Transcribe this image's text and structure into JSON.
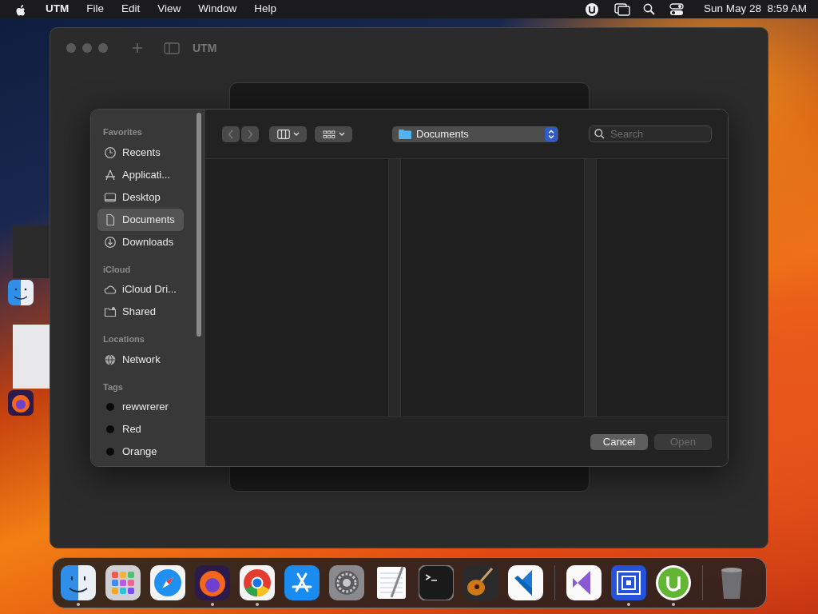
{
  "menu_bar": {
    "app": "UTM",
    "menus": [
      "File",
      "Edit",
      "View",
      "Window",
      "Help"
    ],
    "clock": "Sun May 28  8:59 AM"
  },
  "window": {
    "title": "UTM"
  },
  "open_dialog": {
    "location": "Documents",
    "search": {
      "placeholder": "Search"
    },
    "sidebar": [
      {
        "heading": "Favorites",
        "items": [
          {
            "label": "Recents",
            "kind": "clock",
            "selected": false
          },
          {
            "label": "Applicati...",
            "kind": "apps",
            "selected": false
          },
          {
            "label": "Desktop",
            "kind": "desktop",
            "selected": false
          },
          {
            "label": "Documents",
            "kind": "doc",
            "selected": true
          },
          {
            "label": "Downloads",
            "kind": "download",
            "selected": false
          }
        ]
      },
      {
        "heading": "iCloud",
        "items": [
          {
            "label": "iCloud Dri...",
            "kind": "cloud",
            "selected": false
          },
          {
            "label": "Shared",
            "kind": "shared",
            "selected": false
          }
        ]
      },
      {
        "heading": "Locations",
        "items": [
          {
            "label": "Network",
            "kind": "globe",
            "selected": false
          }
        ]
      },
      {
        "heading": "Tags",
        "items": [
          {
            "label": "rewwrerer",
            "kind": "tag",
            "selected": false
          },
          {
            "label": "Red",
            "kind": "tag",
            "selected": false
          },
          {
            "label": "Orange",
            "kind": "tag",
            "selected": false
          }
        ]
      }
    ],
    "buttons": [
      {
        "label": "Cancel",
        "disabled": false
      },
      {
        "label": "Open",
        "disabled": true
      }
    ]
  },
  "dock": [
    {
      "kind": "finder",
      "running": true
    },
    {
      "kind": "launchpad",
      "running": false
    },
    {
      "kind": "safari",
      "running": false
    },
    {
      "kind": "firefox",
      "running": true
    },
    {
      "kind": "chrome",
      "running": true
    },
    {
      "kind": "appstore",
      "running": false
    },
    {
      "kind": "settings",
      "running": false
    },
    {
      "kind": "textedit",
      "running": false
    },
    {
      "kind": "terminal",
      "running": false
    },
    {
      "kind": "guitar",
      "running": false
    },
    {
      "kind": "vscode",
      "running": false
    },
    {
      "kind": "separator"
    },
    {
      "kind": "vstudio",
      "running": false
    },
    {
      "kind": "squares",
      "running": true
    },
    {
      "kind": "torrent",
      "running": true
    },
    {
      "kind": "separator"
    },
    {
      "kind": "trash",
      "running": false
    }
  ]
}
